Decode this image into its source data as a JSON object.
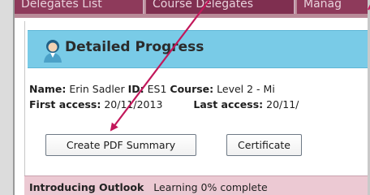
{
  "tabs": [
    {
      "label": "Delegates List"
    },
    {
      "label": "Course Delegates"
    },
    {
      "label": "Manag"
    }
  ],
  "page": {
    "title": "Detailed Progress"
  },
  "info": {
    "name_label": "Name:",
    "name_value": "Erin Sadler",
    "id_label": "ID:",
    "id_value": "ES1",
    "course_label": "Course:",
    "course_value": "Level 2 - Mi",
    "first_access_label": "First access:",
    "first_access_value": "20/11/2013",
    "last_access_label": "Last access:",
    "last_access_value": "20/11/"
  },
  "buttons": {
    "pdf": "Create PDF Summary",
    "certificate": "Certificate"
  },
  "progress": {
    "course_name": "Introducing Outlook",
    "status": "Learning 0% complete"
  },
  "colors": {
    "tab_bg": "#8e3a5b",
    "heading_bar": "#79cbe7",
    "progress_row": "#ecc9d3",
    "arrow": "#c2185b"
  },
  "icons": {
    "avatar": "user-avatar-icon"
  }
}
